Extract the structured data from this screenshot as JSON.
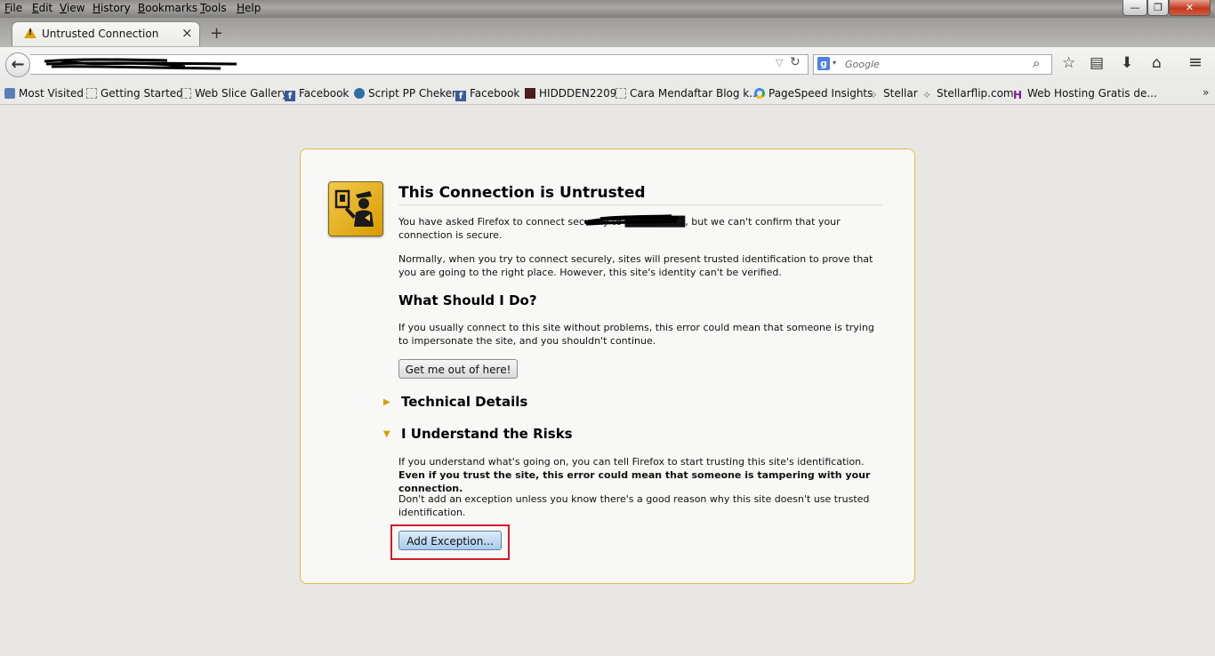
{
  "menu": [
    "File",
    "Edit",
    "View",
    "History",
    "Bookmarks",
    "Tools",
    "Help"
  ],
  "window": {
    "minimize": "—",
    "maximize": "❐",
    "close": "✕"
  },
  "tab": {
    "title": "Untrusted Connection",
    "close": "×",
    "new_tab": "+",
    "warn_mark": "!"
  },
  "navbar": {
    "back": "←",
    "url_dropdown": "▽",
    "reload": "↻",
    "search_engine_icon": "g",
    "search_dropdown": "▾",
    "search_placeholder": "Google",
    "search_icon": "⌕",
    "bookmark_star": "☆",
    "bookmarks_menu": "▤",
    "downloads": "⬇",
    "home": "⌂",
    "menu": "≡"
  },
  "bookmarks": [
    {
      "label": "Most Visited",
      "icon": "most-visited-icon"
    },
    {
      "label": "Getting Started",
      "icon": "dashed-page-icon"
    },
    {
      "label": "Web Slice Gallery",
      "icon": "dashed-page-icon"
    },
    {
      "label": "Facebook",
      "icon": "facebook-icon"
    },
    {
      "label": "Script PP Cheker",
      "icon": "globe-icon"
    },
    {
      "label": "Facebook",
      "icon": "facebook-icon"
    },
    {
      "label": "HIDDDEN2209",
      "icon": "site-icon"
    },
    {
      "label": "Cara Mendaftar Blog k...",
      "icon": "dashed-page-icon"
    },
    {
      "label": "PageSpeed Insights",
      "icon": "pagespeed-icon"
    },
    {
      "label": "Stellar",
      "icon": "star-icon"
    },
    {
      "label": "Stellarflip.com",
      "icon": "star-icon"
    },
    {
      "label": "Web Hosting Gratis de...",
      "icon": "hosting-icon"
    }
  ],
  "bookmarks_more": "»",
  "error": {
    "title": "This Connection is Untrusted",
    "p1": "You have asked Firefox to connect securely to ████████, but we can't confirm that your connection is secure.",
    "p2": "Normally, when you try to connect securely, sites will present trusted identification to prove that you are going to the right place. However, this site's identity can't be verified.",
    "what_heading": "What Should I Do?",
    "p3": "If you usually connect to this site without problems, this error could mean that someone is trying to impersonate the site, and you shouldn't continue.",
    "get_out_button": "Get me out of here!",
    "tech_heading": "Technical Details",
    "tech_toggle": "▶",
    "risks_heading": "I Understand the Risks",
    "risks_toggle": "▼",
    "p4_normal": "If you understand what's going on, you can tell Firefox to start trusting this site's identification. ",
    "p4_bold": "Even if you trust the site, this error could mean that someone is tampering with your connection.",
    "p5": "Don't add an exception unless you know there's a good reason why this site doesn't use trusted identification.",
    "add_exception_button": "Add Exception..."
  }
}
